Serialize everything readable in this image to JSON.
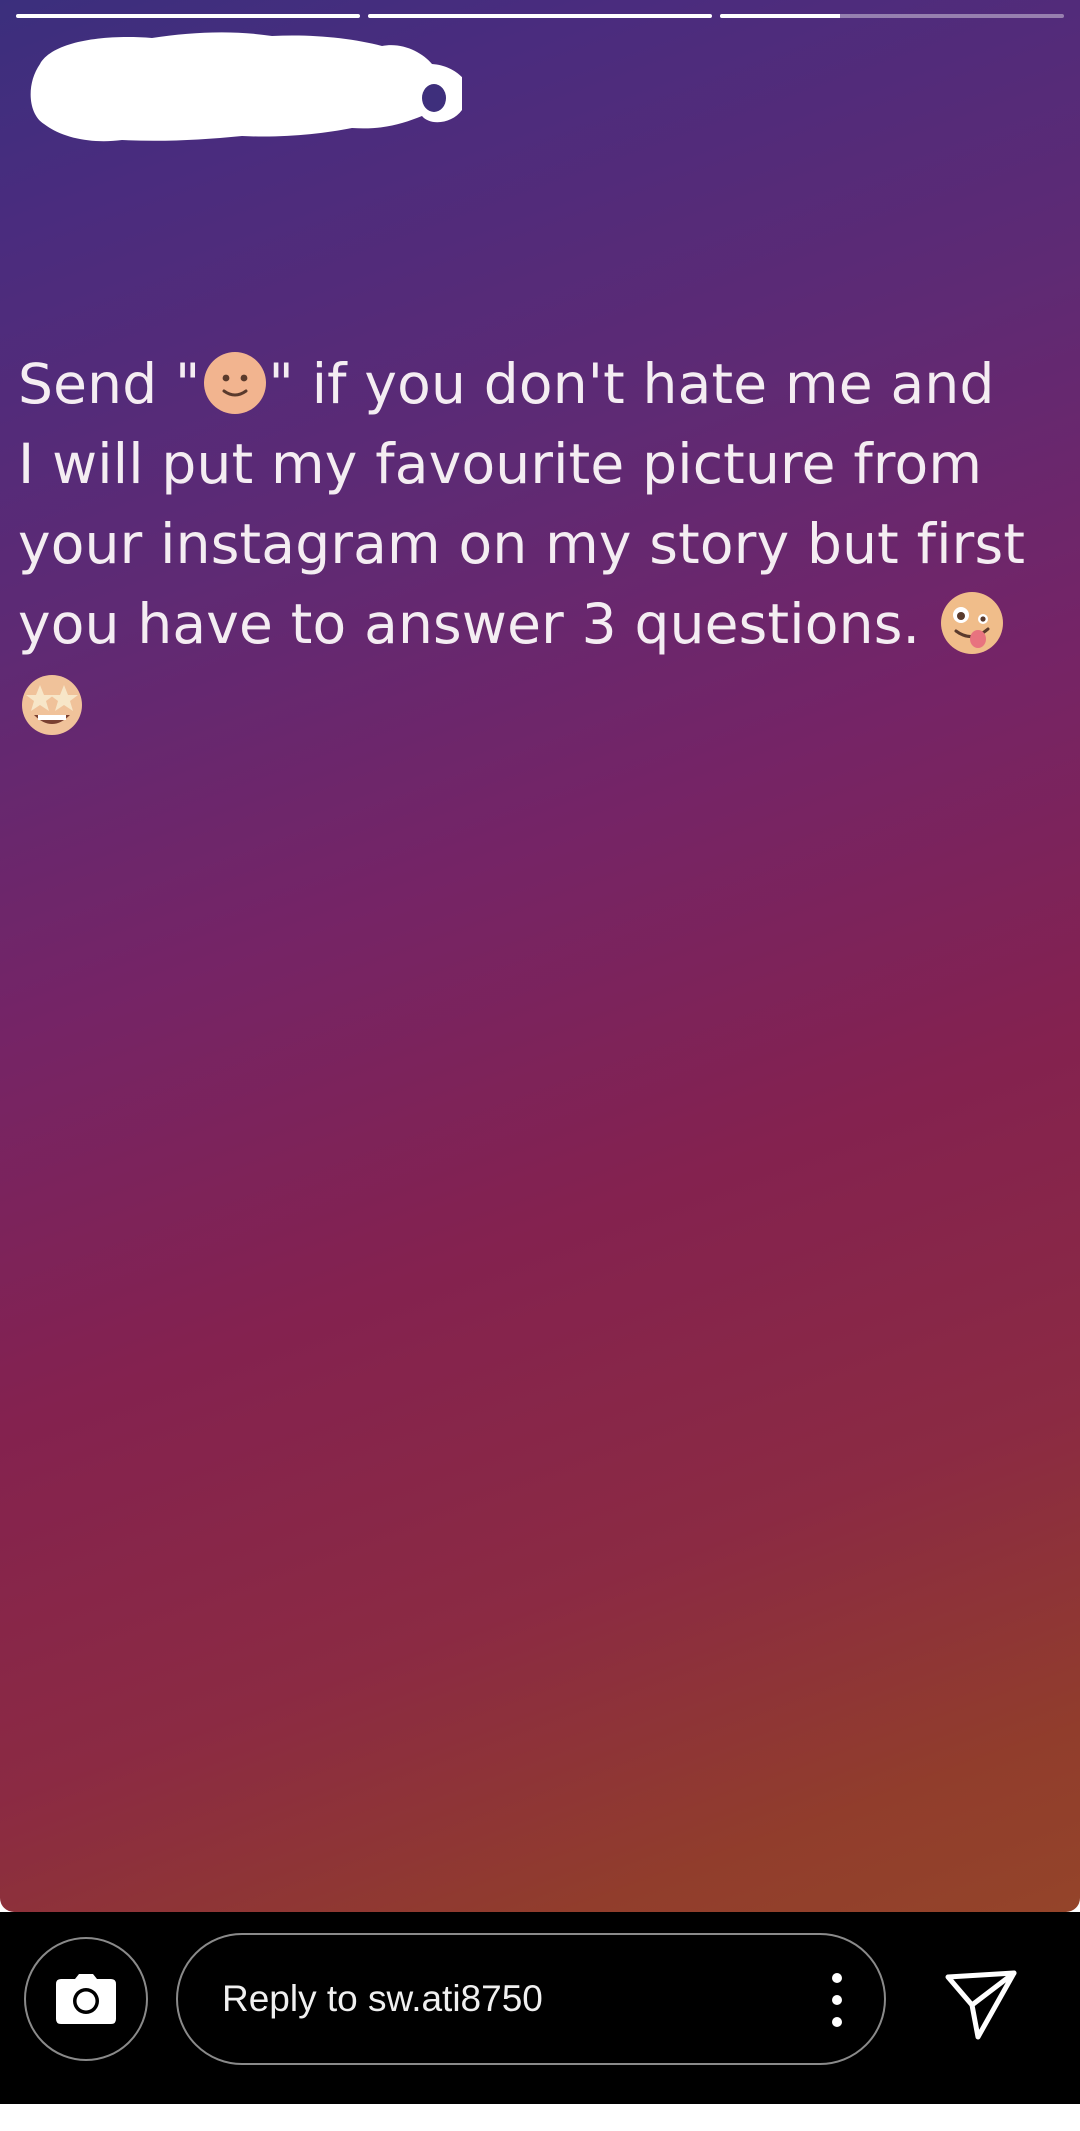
{
  "story": {
    "progress": [
      1,
      1,
      0.35
    ],
    "lines": [
      [
        "Send \"",
        "\" if you don't hate me and"
      ],
      [
        "I will put my favourite picture from"
      ],
      [
        "your instagram on my story but first"
      ],
      [
        "you have to answer 3 questions. "
      ]
    ],
    "emojis": [
      "slightly-smiling-face",
      "zany-face",
      "star-struck-face"
    ]
  },
  "reply_bar": {
    "placeholder": "Reply to sw.ati8750"
  },
  "icons": {
    "camera": "camera-icon",
    "more": "more-vertical-icon",
    "send": "send-icon"
  },
  "colors": {
    "gradient_top": "#3b2f7d",
    "gradient_mid": "#84224f",
    "gradient_bottom": "#94442a",
    "text": "#f4edf2",
    "bar": "#000000"
  }
}
